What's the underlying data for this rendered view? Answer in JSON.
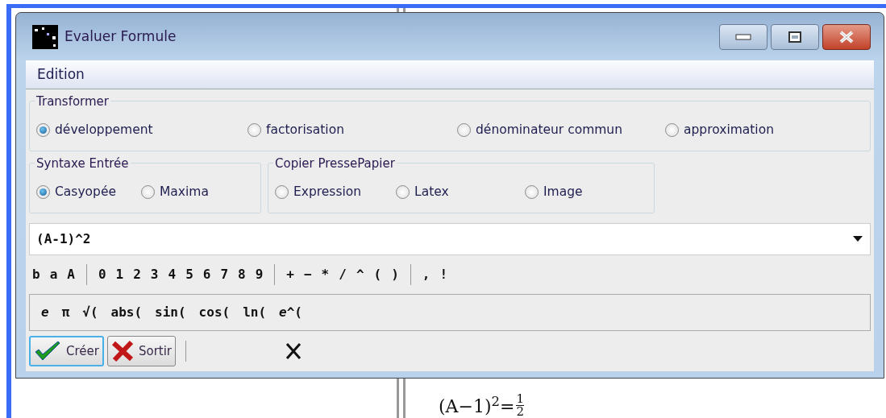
{
  "window": {
    "title": "Evaluer Formule"
  },
  "menu": [
    "Edition"
  ],
  "transform": {
    "title": "Transformer",
    "options": [
      {
        "label": "développement",
        "selected": true
      },
      {
        "label": "factorisation",
        "selected": false
      },
      {
        "label": "dénominateur commun",
        "selected": false
      },
      {
        "label": "approximation",
        "selected": false
      }
    ]
  },
  "syntax": {
    "title": "Syntaxe Entrée",
    "options": [
      {
        "label": "Casyopée",
        "selected": true
      },
      {
        "label": "Maxima",
        "selected": false
      }
    ]
  },
  "clipboard": {
    "title": "Copier PressePapier",
    "options": [
      {
        "label": "Expression",
        "selected": false
      },
      {
        "label": "Latex",
        "selected": false
      },
      {
        "label": "Image",
        "selected": false
      }
    ]
  },
  "formula": {
    "value": "(A-1)^2"
  },
  "keys": [
    [
      "b",
      "a",
      "A"
    ],
    [
      "0",
      "1",
      "2",
      "3",
      "4",
      "5",
      "6",
      "7",
      "8",
      "9"
    ],
    [
      "+",
      "−",
      "*",
      "/",
      "^",
      "(",
      ")"
    ],
    [
      ",",
      "!"
    ]
  ],
  "functions": [
    "*e*",
    "π",
    "√(",
    "abs(",
    "sin(",
    "cos(",
    "ln(",
    "*e*^("
  ],
  "buttons": [
    {
      "label": "Créer",
      "kind": "confirm",
      "focused": true
    },
    {
      "label": "Sortir",
      "kind": "cancel",
      "focused": false
    }
  ],
  "background_formula": {
    "expression": "(A−1)$^{2}$=",
    "numerator": "1",
    "denominator": "2"
  }
}
